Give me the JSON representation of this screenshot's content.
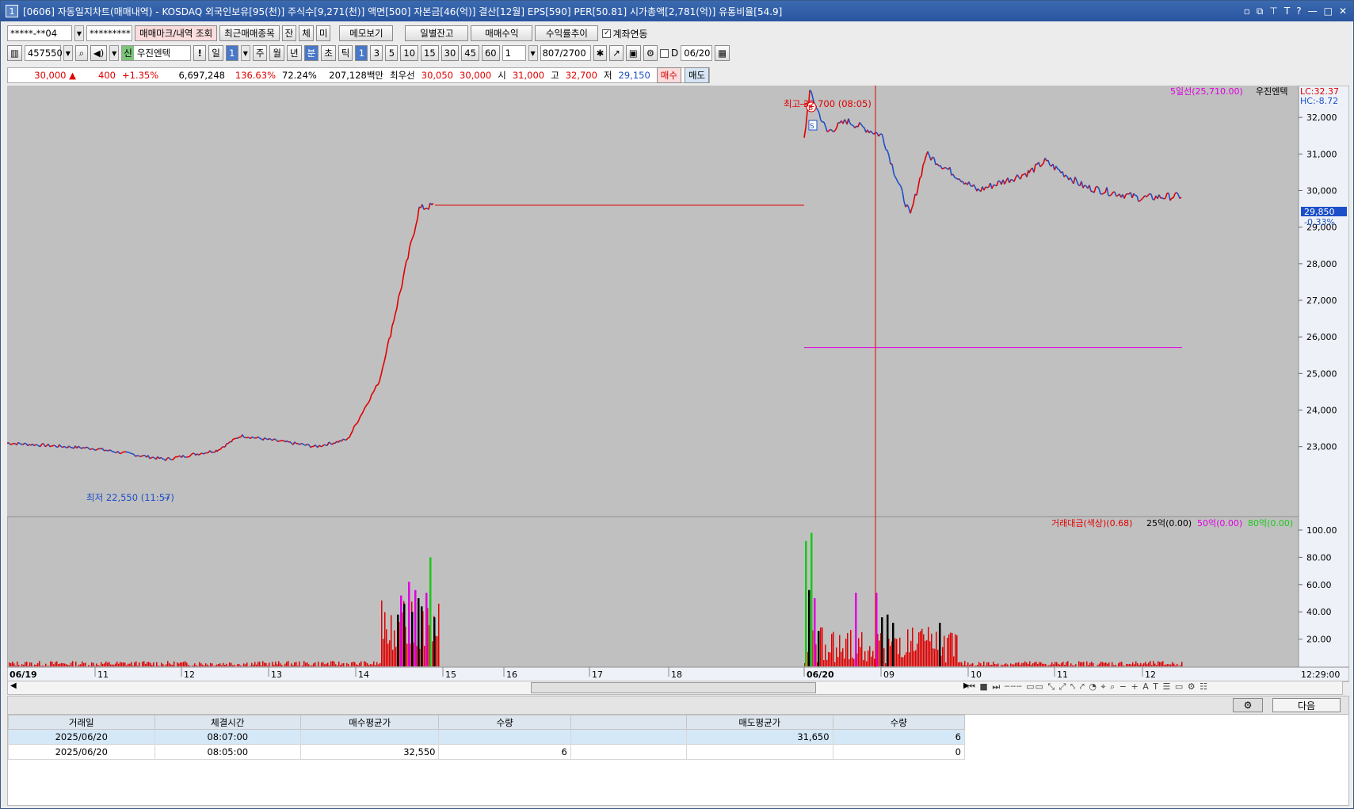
{
  "window": {
    "number": "1",
    "title": "[0606] 자동일지차트(매매내역) - KOSDAQ 외국인보유[95(천)] 주식수[9,271(천)] 액면[500] 자본금[46(억)] 결산[12월] EPS[590] PER[50.81] 시가총액[2,781(억)] 유통비율[54.9]",
    "controls": [
      "▫",
      "⧉",
      "⊤",
      "T",
      "?",
      "—",
      "□",
      "✕"
    ]
  },
  "toolbar1": {
    "account": "*****-**04",
    "password": "*********",
    "b1": "매매마크/내역 조회",
    "b2": "최근매매종목",
    "b3": "잔",
    "b4": "체",
    "b5": "미",
    "b6": "메모보기",
    "b7": "일별잔고",
    "b8": "매매수익",
    "b9": "수익률추이",
    "link_label": "계좌연동"
  },
  "toolbar2": {
    "code": "457550",
    "badge": "신",
    "name": "우진엔텍",
    "excl": "!",
    "p1": "일",
    "p1v": "1",
    "periods": [
      "주",
      "월",
      "년",
      "분",
      "초",
      "틱"
    ],
    "mins": [
      "1",
      "3",
      "5",
      "10",
      "15",
      "30",
      "45",
      "60"
    ],
    "unit": "1",
    "count": "807",
    "total": "/2700",
    "d": "D",
    "date": "06/20"
  },
  "quote": {
    "price": "30,000 ▲",
    "change": "400",
    "rate": "+1.35%",
    "volume": "6,697,248",
    "vr": "136.63%",
    "r2": "72.24%",
    "amount": "207,128백만",
    "lbl1": "최우선",
    "ask": "30,050",
    "bid": "30,000",
    "lo": "시",
    "open": "31,000",
    "lh": "고",
    "high": "32,700",
    "ll": "저",
    "low": "29,150",
    "buy": "매수",
    "sell": "매도"
  },
  "chart_data": {
    "type": "line",
    "title": "",
    "legend_top": {
      "ma": "5일선(25,710.00)",
      "name": "우진엔텍",
      "lc": "LC:32.37",
      "hc": "HC:-8.72"
    },
    "current": {
      "price": "29,850",
      "change": "-0.33%"
    },
    "annotations": {
      "high": "최고 32,700 (08:05)",
      "low": "최저 22,550 (11:57)",
      "buy_mark": "B",
      "sell_mark": "S"
    },
    "yticks": [
      "32,000",
      "31,000",
      "30,000",
      "29,000",
      "28,000",
      "27,000",
      "26,000",
      "25,000",
      "24,000",
      "23,000"
    ],
    "ylim": [
      22300,
      33000
    ],
    "ma5_day2": 25710,
    "series": [
      {
        "name": "",
        "x": [
          "06/19 10:00",
          "11:00",
          "12:00",
          "12:45",
          "13:00",
          "14:00",
          "14:20",
          "14:40",
          "14:50",
          "14:55",
          "15:00"
        ],
        "y": [
          23100,
          22950,
          22650,
          22900,
          23300,
          23000,
          23200,
          24800,
          27600,
          29500,
          29600
        ]
      },
      {
        "name": "",
        "x": [
          "06/20 08:00",
          "08:05",
          "08:20",
          "08:40",
          "09:00",
          "09:15",
          "09:30",
          "09:40",
          "10:00",
          "10:30",
          "11:00",
          "11:30",
          "12:00",
          "12:29"
        ],
        "y": [
          31400,
          32700,
          31600,
          31900,
          31500,
          30500,
          29300,
          31000,
          30000,
          30500,
          30800,
          30100,
          29800,
          29850
        ]
      }
    ],
    "volume_legend": {
      "a": "거래대금(색상)(0.68)",
      "b": "25억(0.00)",
      "c": "50억(0.00)",
      "d": "80억(0.00)"
    },
    "vol_yticks": [
      "100.00",
      "80.00",
      "60.00",
      "40.00",
      "20.00"
    ],
    "xticks": [
      "06/19",
      "11",
      "12",
      "13",
      "14",
      "15",
      "16",
      "17",
      "18",
      "06/20",
      "09",
      "10",
      "11",
      "12"
    ],
    "time_label": "12:29:00"
  },
  "bottom": {
    "next": "다음"
  },
  "table": {
    "headers": [
      "거래일",
      "체결시간",
      "매수평균가",
      "수량",
      "",
      "매도평균가",
      "수량"
    ],
    "rows": [
      [
        "2025/06/20",
        "08:07:00",
        "",
        "",
        "",
        "31,650",
        "6"
      ],
      [
        "2025/06/20",
        "08:05:00",
        "32,550",
        "6",
        "",
        "",
        "0"
      ]
    ]
  },
  "colors": {
    "up": "#e00000",
    "down": "#1c4fc9",
    "ma": "#e000e0",
    "bg": "#c0c0c0",
    "axis": "#eef2f8"
  }
}
